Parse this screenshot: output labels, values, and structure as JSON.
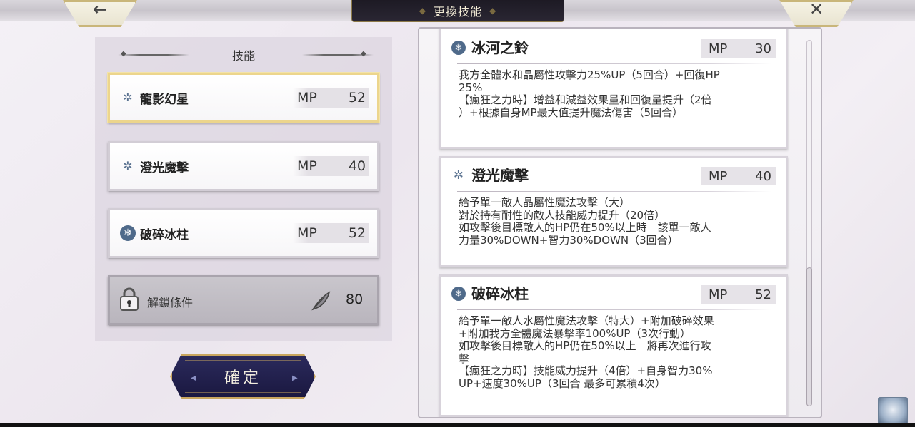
{
  "header": {
    "title": "更換技能",
    "back_glyph": "←",
    "close_glyph": "✕"
  },
  "left_panel": {
    "heading": "技能",
    "skills": [
      {
        "name": "龍影幻星",
        "mp_label": "MP",
        "mp_value": "52",
        "icon": "crystal-outline-icon",
        "selected": true
      },
      {
        "name": "澄光魔擊",
        "mp_label": "MP",
        "mp_value": "40",
        "icon": "crystal-outline-icon",
        "selected": false
      },
      {
        "name": "破碎冰柱",
        "mp_label": "MP",
        "mp_value": "52",
        "icon": "water-orb-icon",
        "selected": false
      }
    ],
    "locked_slot": {
      "label": "解鎖條件",
      "value": "80",
      "icon": "lock-icon",
      "cost_icon": "feather-icon"
    },
    "confirm_label": "確定"
  },
  "details": [
    {
      "name": "冰河之鈴",
      "mp_label": "MP",
      "mp_value": "30",
      "icon": "water-orb-icon",
      "desc": "我方全體水和晶屬性攻擊力25%UP（5回合）+回復HP\n25%\n【瘋狂之力時】增益和減益效果量和回復量提升（2倍\n）+根據自身MP最大值提升魔法傷害（5回合）"
    },
    {
      "name": "澄光魔擊",
      "mp_label": "MP",
      "mp_value": "40",
      "icon": "crystal-outline-icon",
      "desc": "給予單一敵人晶屬性魔法攻擊（大）\n對於持有耐性的敵人技能威力提升（20倍）\n如攻擊後目標敵人的HP仍在50%以上時　該單一敵人\n力量30%DOWN+智力30%DOWN（3回合）"
    },
    {
      "name": "破碎冰柱",
      "mp_label": "MP",
      "mp_value": "52",
      "icon": "water-orb-icon",
      "desc": "給予單一敵人水屬性魔法攻擊（特大）+附加破碎效果\n+附加我方全體魔法暴擊率100%UP（3次行動）\n如攻擊後目標敵人的HP仍在50%以上　將再次進行攻\n擊\n【瘋狂之力時】技能威力提升（4倍）+自身智力30%\nUP+速度30%UP（3回合 最多可累積4次）"
    }
  ],
  "colors": {
    "accent_gold": "#c9a65e",
    "selected_border": "#ecd58c",
    "confirm_bg": "#1a1840",
    "water_icon": "#4f6a8a"
  }
}
